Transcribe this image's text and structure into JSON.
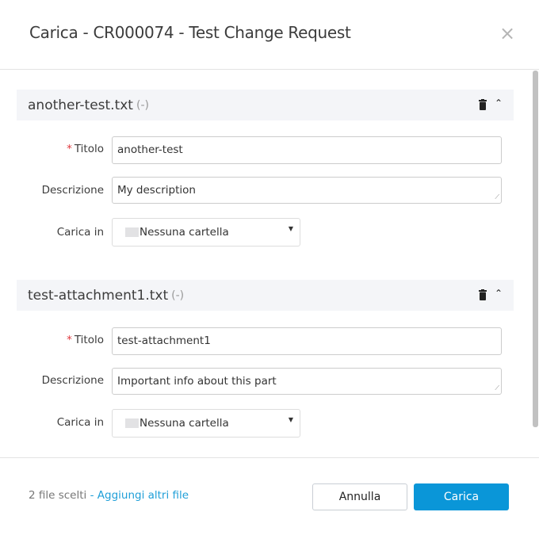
{
  "dialog": {
    "title": "Carica - CR000074 - Test Change Request",
    "close_icon": "×"
  },
  "files": [
    {
      "name": "another-test.txt",
      "size": "(-)",
      "title_label": "Titolo",
      "title_value": "another-test",
      "desc_label": "Descrizione",
      "desc_value": "My description",
      "folder_label": "Carica in",
      "folder_value": "Nessuna cartella"
    },
    {
      "name": "test-attachment1.txt",
      "size": "(-)",
      "title_label": "Titolo",
      "title_value": "test-attachment1",
      "desc_label": "Descrizione",
      "desc_value": "Important info about this part",
      "folder_label": "Carica in",
      "folder_value": "Nessuna cartella"
    }
  ],
  "footer": {
    "count": "2 file scelti",
    "sep": " - ",
    "add_more": "Aggiungi altri file",
    "cancel": "Annulla",
    "upload": "Carica"
  },
  "required_mark": "*"
}
